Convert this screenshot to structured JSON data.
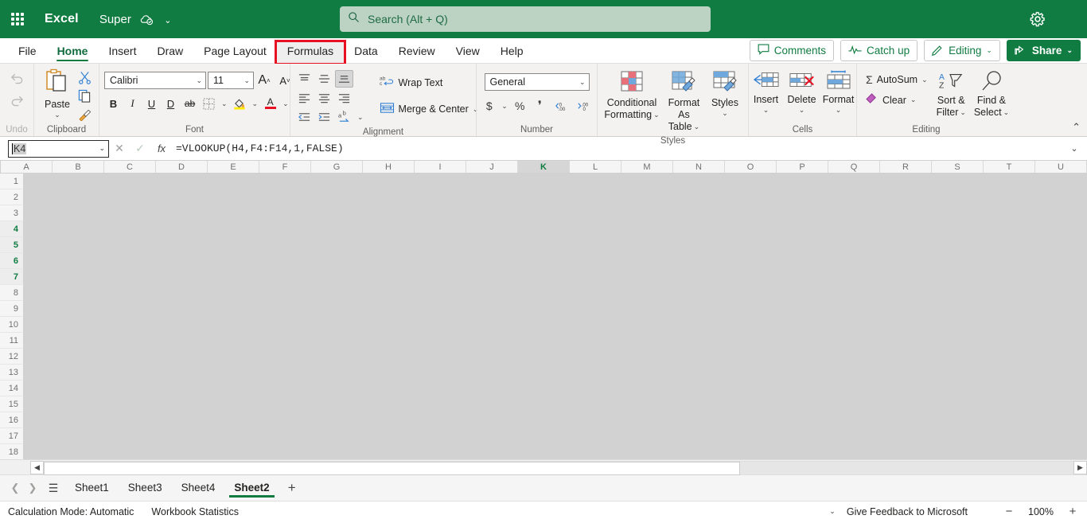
{
  "titlebar": {
    "app_name": "Excel",
    "document_name": "Super",
    "waffle_icon": "app-launcher-icon",
    "cloud_icon": "cloud-saved-icon",
    "settings_icon": "gear-icon",
    "search": {
      "placeholder": "Search (Alt + Q)",
      "value": "",
      "icon": "search-icon"
    }
  },
  "ribbon_tabs": {
    "items": [
      {
        "label": "File",
        "state": "normal"
      },
      {
        "label": "Home",
        "state": "active"
      },
      {
        "label": "Insert",
        "state": "normal"
      },
      {
        "label": "Draw",
        "state": "normal"
      },
      {
        "label": "Page Layout",
        "state": "normal"
      },
      {
        "label": "Formulas",
        "state": "flagged"
      },
      {
        "label": "Data",
        "state": "normal"
      },
      {
        "label": "Review",
        "state": "normal"
      },
      {
        "label": "View",
        "state": "normal"
      },
      {
        "label": "Help",
        "state": "normal"
      }
    ],
    "highlight_color": "#e81123",
    "actions": [
      {
        "label": "Comments",
        "icon": "comment-icon"
      },
      {
        "label": "Catch up",
        "icon": "activity-icon"
      },
      {
        "label": "Editing",
        "icon": "pencil-icon",
        "chevron": true
      },
      {
        "label": "Share",
        "icon": "share-icon",
        "chevron": true,
        "primary": true
      }
    ]
  },
  "ribbon": {
    "undo": {
      "undo_label": "Undo",
      "undo_icon": "undo-arrow-icon",
      "redo_icon": "redo-arrow-icon"
    },
    "clipboard": {
      "group_label": "Clipboard",
      "paste_label": "Paste",
      "paste_icon": "paste-clipboard-icon",
      "cut_icon": "scissors-icon",
      "copy_icon": "copy-icon",
      "format_painter_icon": "format-painter-icon"
    },
    "font": {
      "group_label": "Font",
      "font_name": "Calibri",
      "font_size": "11",
      "grow_font_label": "A",
      "shrink_font_label": "A",
      "bold": "B",
      "italic": "I",
      "underline": "U",
      "double_underline": "D",
      "strikethrough": "ab",
      "borders_icon": "borders-icon",
      "fill_color_icon": "fill-color-icon",
      "font_color_icon": "font-color-icon",
      "fill_color": "#ffeb00",
      "font_color": "#e81123"
    },
    "alignment": {
      "group_label": "Alignment",
      "wrap_text_label": "Wrap Text",
      "wrap_text_icon": "wrap-text-icon",
      "merge_center_label": "Merge & Center",
      "merge_center_icon": "merge-center-icon",
      "align_top_icon": "align-top-icon",
      "align_middle_icon": "align-middle-icon",
      "align_bottom_icon": "align-bottom-icon",
      "align_left_icon": "align-left-icon",
      "align_center_icon": "align-center-icon",
      "align_right_icon": "align-right-icon",
      "decrease_indent_icon": "decrease-indent-icon",
      "increase_indent_icon": "increase-indent-icon",
      "orientation_icon": "text-orientation-icon"
    },
    "number": {
      "group_label": "Number",
      "format": "General",
      "currency_icon": "dollar-icon",
      "percent_icon": "percent-icon",
      "comma_icon": "comma-style-icon",
      "increase_decimal_icon": "increase-decimal-icon",
      "decrease_decimal_icon": "decrease-decimal-icon"
    },
    "styles": {
      "group_label": "Styles",
      "conditional_formatting_line1": "Conditional",
      "conditional_formatting_line2": "Formatting",
      "conditional_formatting_icon": "conditional-formatting-icon",
      "format_as_table_line1": "Format As",
      "format_as_table_line2": "Table",
      "format_as_table_icon": "format-as-table-icon",
      "styles_label": "Styles",
      "styles_icon": "cell-styles-icon"
    },
    "cells": {
      "group_label": "Cells",
      "insert_label": "Insert",
      "insert_icon": "insert-cells-icon",
      "delete_label": "Delete",
      "delete_icon": "delete-cells-icon",
      "format_label": "Format",
      "format_icon": "format-cells-icon"
    },
    "editing": {
      "group_label": "Editing",
      "autosum_label": "AutoSum",
      "autosum_icon": "sigma-icon",
      "clear_label": "Clear",
      "clear_icon": "eraser-icon",
      "sort_filter_line1": "Sort &",
      "sort_filter_line2": "Filter",
      "sort_filter_icon": "sort-filter-icon",
      "find_select_line1": "Find &",
      "find_select_line2": "Select",
      "find_select_icon": "magnifier-icon"
    },
    "collapse_icon": "chevron-up-icon"
  },
  "formula_bar": {
    "name_box": "K4",
    "cancel_icon": "cancel-x-icon",
    "enter_icon": "confirm-check-icon",
    "function_icon": "fx-icon",
    "formula": "=VLOOKUP(H4,F4:F14,1,FALSE)",
    "expand_icon": "chevron-down-icon"
  },
  "grid": {
    "columns": [
      "A",
      "B",
      "C",
      "D",
      "E",
      "F",
      "G",
      "H",
      "I",
      "J",
      "K",
      "L",
      "M",
      "N",
      "O",
      "P",
      "Q",
      "R",
      "S",
      "T",
      "U"
    ],
    "highlighted_column": "K",
    "rows": [
      1,
      2,
      3,
      4,
      5,
      6,
      7,
      8,
      9,
      10,
      11,
      12,
      13,
      14,
      15,
      16,
      17,
      18
    ],
    "highlighted_rows": [
      4,
      5,
      6,
      7
    ],
    "selected_cell": "K4"
  },
  "scrollbar": {
    "left_arrow": "◀",
    "right_arrow": "▶"
  },
  "sheet_tabs": {
    "prev_icon": "chevron-left-icon",
    "next_icon": "chevron-right-icon",
    "all_sheets_icon": "hamburger-icon",
    "items": [
      {
        "label": "Sheet1",
        "active": false
      },
      {
        "label": "Sheet3",
        "active": false
      },
      {
        "label": "Sheet4",
        "active": false
      },
      {
        "label": "Sheet2",
        "active": true
      }
    ],
    "add_label": "+"
  },
  "status_bar": {
    "calculation_mode": "Calculation Mode: Automatic",
    "workbook_statistics": "Workbook Statistics",
    "options_chevron": "chevron-down-icon",
    "feedback": "Give Feedback to Microsoft",
    "zoom_out": "−",
    "zoom_level": "100%",
    "zoom_in": "+"
  }
}
